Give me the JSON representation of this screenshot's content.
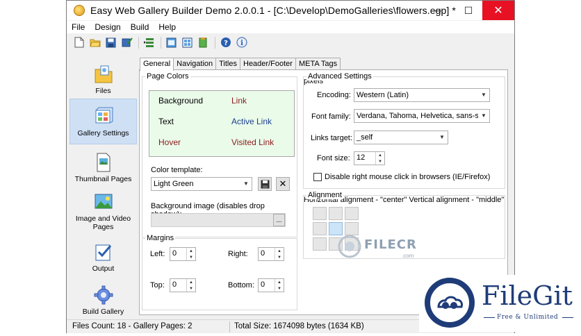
{
  "window": {
    "title": "Easy Web Gallery Builder Demo 2.0.0.1 - [C:\\Develop\\DemoGalleries\\flowers.egp] *",
    "controls": {
      "minimize": "─",
      "maximize": "☐",
      "close": "✕"
    }
  },
  "menu": [
    "File",
    "Design",
    "Build",
    "Help"
  ],
  "toolbar": {
    "icons": [
      "new-file-icon",
      "open-folder-icon",
      "save-icon",
      "save-as-icon",
      "build-icon",
      "gallery-view-icon",
      "thumbnail-view-icon",
      "publish-icon",
      "help-icon",
      "about-icon"
    ]
  },
  "sidebar": {
    "items": [
      {
        "label": "Files",
        "icon": "files-icon",
        "active": false
      },
      {
        "label": "Gallery Settings",
        "icon": "gallery-settings-icon",
        "active": true
      },
      {
        "label": "Thumbnail Pages",
        "icon": "thumbnail-pages-icon",
        "active": false
      },
      {
        "label": "Image and Video Pages",
        "icon": "image-video-pages-icon",
        "active": false
      },
      {
        "label": "Output",
        "icon": "output-icon",
        "active": false
      },
      {
        "label": "Build Gallery",
        "icon": "build-gallery-icon",
        "active": false
      }
    ]
  },
  "tabs": [
    {
      "label": "General",
      "active": true
    },
    {
      "label": "Navigation",
      "active": false
    },
    {
      "label": "Titles",
      "active": false
    },
    {
      "label": "Header/Footer",
      "active": false
    },
    {
      "label": "META Tags",
      "active": false
    }
  ],
  "page_colors": {
    "title": "Page Colors",
    "background": "Background",
    "link": "Link",
    "text": "Text",
    "active_link": "Active Link",
    "hover": "Hover",
    "visited_link": "Visited Link",
    "colors": {
      "preview_bg": "#eafbea",
      "text": "#000000",
      "link": "#8b1a1a",
      "active_link": "#1a3e8c",
      "hover": "#8b1a1a",
      "visited_link": "#8b1a1a"
    }
  },
  "color_template": {
    "label": "Color template:",
    "value": "Light Green"
  },
  "background_image": {
    "label": "Background image (disables drop shadow):",
    "value": "",
    "browse": "..."
  },
  "margins": {
    "title": "Margins",
    "left_label": "Left:",
    "left": "0",
    "right_label": "Right:",
    "right": "0",
    "top_label": "Top:",
    "top": "0",
    "bottom_label": "Bottom:",
    "bottom": "0"
  },
  "advanced": {
    "title": "Advanced Settings",
    "encoding_label": "Encoding:",
    "encoding": "Western (Latin)",
    "font_family_label": "Font family:",
    "font_family": "Verdana, Tahoma, Helvetica, sans-serif",
    "links_target_label": "Links target:",
    "links_target": "_self",
    "font_size_label": "Font size:",
    "font_size": "12",
    "font_size_unit": "pixels",
    "disable_right_click": "Disable right mouse click in browsers (IE/Firefox)",
    "disable_right_click_checked": false
  },
  "alignment": {
    "title": "Alignment",
    "horizontal": "Horizontal alignment - \"center\"",
    "vertical": "Vertical alignment - \"middle\"",
    "selected_row": 1,
    "selected_col": 1
  },
  "status": {
    "files": "Files Count: 18 - Gallery Pages: 2",
    "size": "Total Size: 1674098 bytes (1634 KB)"
  },
  "watermarks": {
    "filecr": "FILECR",
    "filecr_sub": ".com",
    "filegit": "FileGit",
    "filegit_tag": "Free & Unlimited"
  }
}
